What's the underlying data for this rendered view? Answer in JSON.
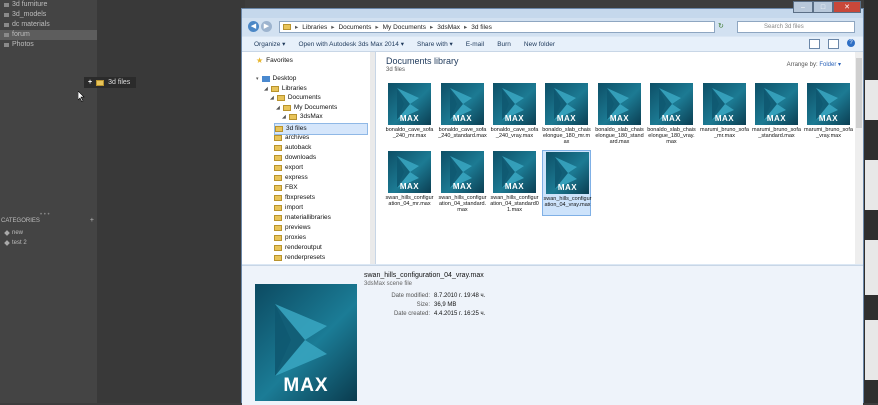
{
  "left_panel": {
    "libraries": [
      {
        "label": "3d furniture",
        "selected": false
      },
      {
        "label": "3d_models",
        "selected": false
      },
      {
        "label": "dc materials",
        "selected": false
      },
      {
        "label": "forum",
        "selected": true
      },
      {
        "label": "Photos",
        "selected": false
      }
    ],
    "categories_title": "CATEGORIES",
    "categories": [
      {
        "label": "new"
      },
      {
        "label": "test 2"
      }
    ]
  },
  "drag_tooltip": {
    "plus": "+",
    "label": "3d files"
  },
  "explorer": {
    "breadcrumb": [
      "Libraries",
      "Documents",
      "My Documents",
      "3dsMax",
      "3d files"
    ],
    "search_placeholder": "Search 3d files",
    "toolbar": [
      "Organize ▾",
      "Open with Autodesk 3ds Max 2014 ▾",
      "Share with ▾",
      "E-mail",
      "Burn",
      "New folder"
    ],
    "nav": [
      {
        "label": "Favorites",
        "icon": "star-icon",
        "level": 0
      },
      {
        "label": "Desktop",
        "icon": "desktop-icon",
        "level": 0
      },
      {
        "label": "Libraries",
        "icon": "folder-icon",
        "level": 1
      },
      {
        "label": "Documents",
        "icon": "folder-icon",
        "level": 2
      },
      {
        "label": "My Documents",
        "icon": "folder-icon",
        "level": 3
      },
      {
        "label": "3dsMax",
        "icon": "folder-icon",
        "level": 4
      },
      {
        "label": "3d files",
        "icon": "folder-icon",
        "level": 5,
        "selected": true
      },
      {
        "label": "archives",
        "icon": "folder-icon",
        "level": 5
      },
      {
        "label": "autoback",
        "icon": "folder-icon",
        "level": 5
      },
      {
        "label": "downloads",
        "icon": "folder-icon",
        "level": 5
      },
      {
        "label": "export",
        "icon": "folder-icon",
        "level": 5
      },
      {
        "label": "express",
        "icon": "folder-icon",
        "level": 5
      },
      {
        "label": "FBX",
        "icon": "folder-icon",
        "level": 5
      },
      {
        "label": "fbxpresets",
        "icon": "folder-icon",
        "level": 5
      },
      {
        "label": "import",
        "icon": "folder-icon",
        "level": 5
      },
      {
        "label": "materiallibraries",
        "icon": "folder-icon",
        "level": 5
      },
      {
        "label": "previews",
        "icon": "folder-icon",
        "level": 5
      },
      {
        "label": "proxies",
        "icon": "folder-icon",
        "level": 5
      },
      {
        "label": "renderoutput",
        "icon": "folder-icon",
        "level": 5
      },
      {
        "label": "renderpresets",
        "icon": "folder-icon",
        "level": 5
      }
    ],
    "library_title": "Documents library",
    "library_subtitle": "3d files",
    "arrange_label": "Arrange by:",
    "arrange_value": "Folder ▾",
    "icon_text": "MAX",
    "files": [
      {
        "name": "bonaldo_cave_sofa_240_mr.max"
      },
      {
        "name": "bonaldo_cave_sofa_240_standard.max"
      },
      {
        "name": "bonaldo_cave_sofa_240_vray.max"
      },
      {
        "name": "bonaldo_slab_chaiselongue_180_mr.max"
      },
      {
        "name": "bonaldo_slab_chaiselongue_180_standard.max"
      },
      {
        "name": "bonaldo_slab_chaiselongue_180_vray.max"
      },
      {
        "name": "marumi_bruno_sofa_mr.max"
      },
      {
        "name": "marumi_bruno_sofa_standard.max"
      },
      {
        "name": "marumi_bruno_sofa_vray.max"
      },
      {
        "name": "swan_hills_configuration_04_mr.max"
      },
      {
        "name": "swan_hills_configuration_04_standard.max"
      },
      {
        "name": "swan_hills_configuration_04_standard01.max"
      },
      {
        "name": "swan_hills_configuration_04_vray.max",
        "selected": true
      }
    ],
    "details": {
      "name": "swan_hills_configuration_04_vray.max",
      "type": "3dsMax scene file",
      "rows": [
        {
          "k": "Date modified:",
          "v": "8.7.2010 г. 19:48 ч."
        },
        {
          "k": "Size:",
          "v": "36,9 MB"
        },
        {
          "k": "Date created:",
          "v": "4.4.2015 г. 16:25 ч."
        }
      ]
    }
  }
}
